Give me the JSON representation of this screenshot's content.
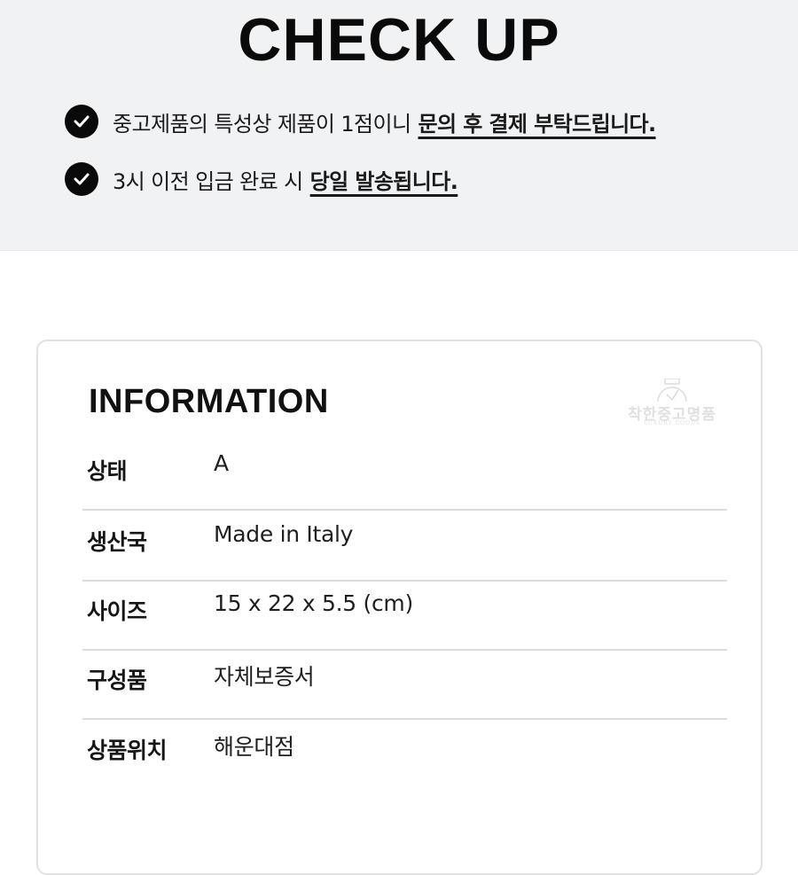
{
  "header": {
    "title": "CHECK UP"
  },
  "notices": [
    {
      "icon": "check-circle-icon",
      "text": "중고제품의 특성상 제품이 1점이니",
      "emphasis": "문의 후 결제 부탁드립니다."
    },
    {
      "icon": "check-circle-icon",
      "text": "3시 이전 입금 완료 시",
      "emphasis": "당일 발송됩니다."
    }
  ],
  "information": {
    "title": "INFORMATION",
    "watermark": {
      "name": "착한중고명품",
      "subtitle": "LUXURY GOODS",
      "icon": "watch-icon"
    },
    "rows": [
      {
        "label": "상태",
        "value": "A"
      },
      {
        "label": "생산국",
        "value": "Made in Italy"
      },
      {
        "label": "사이즈",
        "value": "15 x 22 x 5.5 (cm)"
      },
      {
        "label": "구성품",
        "value": "자체보증서"
      },
      {
        "label": "상품위치",
        "value": "해운대점"
      }
    ]
  }
}
